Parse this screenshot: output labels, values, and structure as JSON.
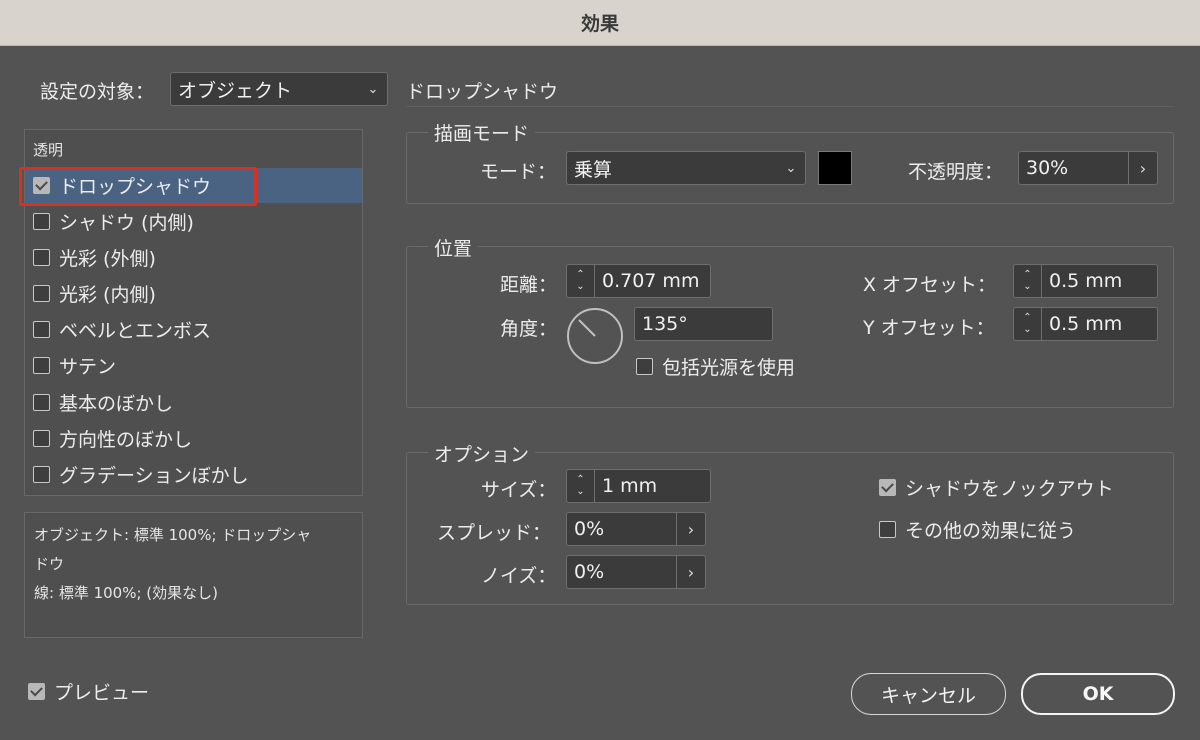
{
  "window": {
    "title": "効果"
  },
  "header": {
    "target_label": "設定の対象：",
    "target_value": "オブジェクト",
    "section_title": "ドロップシャドウ"
  },
  "effects_list": {
    "heading": "透明",
    "items": [
      {
        "label": "ドロップシャドウ",
        "checked": true,
        "selected": true
      },
      {
        "label": "シャドウ (内側)",
        "checked": false
      },
      {
        "label": "光彩 (外側)",
        "checked": false
      },
      {
        "label": "光彩 (内側)",
        "checked": false
      },
      {
        "label": "ベベルとエンボス",
        "checked": false
      },
      {
        "label": "サテン",
        "checked": false
      },
      {
        "label": "基本のぼかし",
        "checked": false
      },
      {
        "label": "方向性のぼかし",
        "checked": false
      },
      {
        "label": "グラデーションぼかし",
        "checked": false
      }
    ]
  },
  "summary": {
    "line1": "オブジェクト: 標準 100%; ドロップシャ",
    "line2": "ドウ",
    "line3": "線: 標準 100%; (効果なし)"
  },
  "blend": {
    "title": "描画モード",
    "mode_label": "モード：",
    "mode_value": "乗算",
    "color": "#000000",
    "opacity_label": "不透明度：",
    "opacity_value": "30%"
  },
  "position": {
    "title": "位置",
    "distance_label": "距離：",
    "distance_value": "0.707 mm",
    "angle_label": "角度：",
    "angle_value": "135°",
    "global_light_label": "包括光源を使用",
    "global_light_checked": false,
    "x_offset_label": "X オフセット：",
    "x_offset_value": "0.5 mm",
    "y_offset_label": "Y オフセット：",
    "y_offset_value": "0.5 mm"
  },
  "options": {
    "title": "オプション",
    "size_label": "サイズ：",
    "size_value": "1 mm",
    "spread_label": "スプレッド：",
    "spread_value": "0%",
    "noise_label": "ノイズ：",
    "noise_value": "0%",
    "knockout_label": "シャドウをノックアウト",
    "knockout_checked": true,
    "honor_effects_label": "その他の効果に従う",
    "honor_effects_checked": false
  },
  "footer": {
    "preview_label": "プレビュー",
    "preview_checked": true,
    "cancel_label": "キャンセル",
    "ok_label": "OK"
  },
  "icons": {
    "dropdown": "chevron-down-icon",
    "arrow": "chevron-right-icon",
    "spinner": "stepper-icon",
    "angle": "angle-dial-icon"
  }
}
